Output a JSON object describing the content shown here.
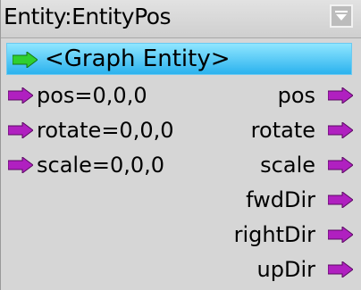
{
  "node": {
    "title": "Entity:EntityPos",
    "entity_label": "<Graph Entity>"
  },
  "inputs": [
    {
      "label": "pos=0,0,0"
    },
    {
      "label": "rotate=0,0,0"
    },
    {
      "label": "scale=0,0,0"
    }
  ],
  "outputs": [
    {
      "label": "pos"
    },
    {
      "label": "rotate"
    },
    {
      "label": "scale"
    },
    {
      "label": "fwdDir"
    },
    {
      "label": "rightDir"
    },
    {
      "label": "upDir"
    }
  ],
  "colors": {
    "entity_pin": "#2fcf2f",
    "value_pin": "#b020c0",
    "entity_row_top": "#8fe6ff",
    "entity_row_bottom": "#2bb2ee"
  }
}
